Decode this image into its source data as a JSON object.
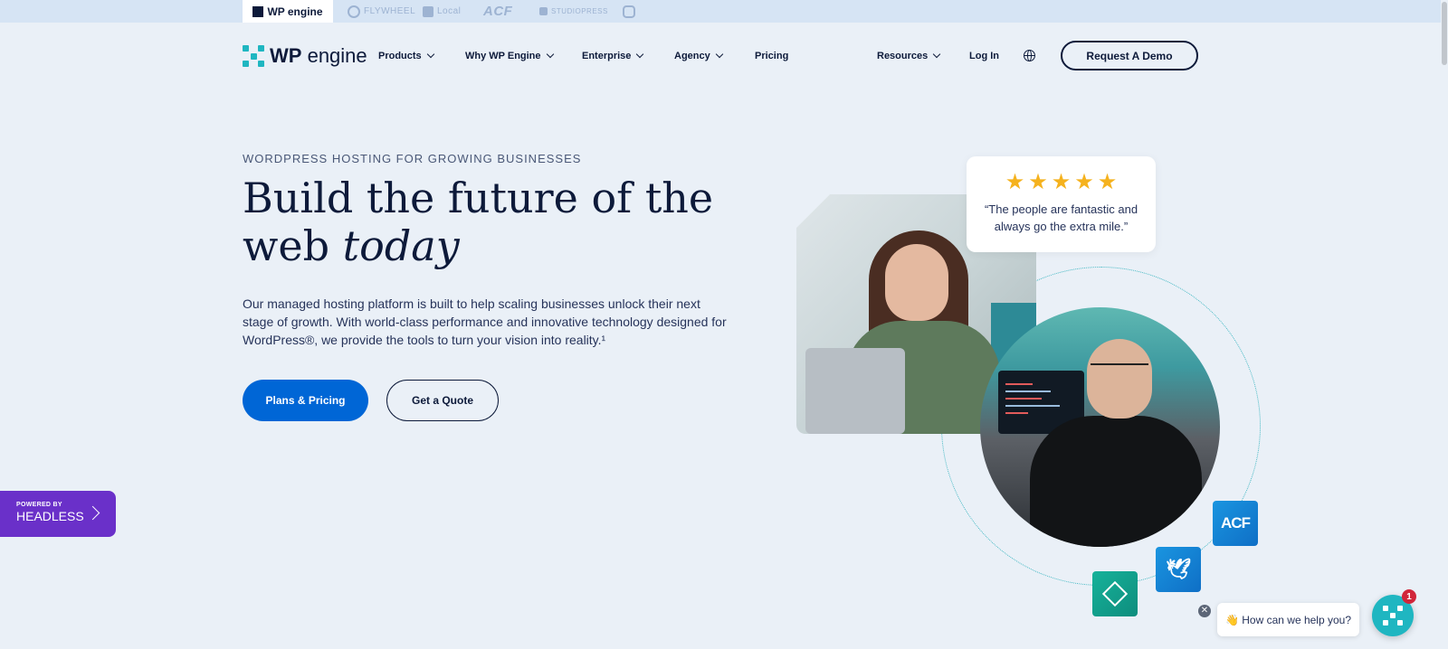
{
  "brandbar": {
    "tabs": [
      {
        "label": "WP engine"
      },
      {
        "label": "FLYWHEEL"
      },
      {
        "label": "Local"
      },
      {
        "label": "ACF"
      },
      {
        "label": "STUDIOPRESS"
      }
    ]
  },
  "nav": {
    "logo_bold": "WP",
    "logo_rest": "engine",
    "items": [
      "Products",
      "Why WP Engine",
      "Enterprise",
      "Agency",
      "Pricing"
    ],
    "resources": "Resources",
    "login": "Log In",
    "demo": "Request A Demo"
  },
  "hero": {
    "eyebrow": "WORDPRESS HOSTING FOR GROWING BUSINESSES",
    "headline_main": "Build the future of the web ",
    "headline_em": "today",
    "body": "Our managed hosting platform is built to help scaling businesses unlock their next stage of growth. With world-class performance and innovative technology designed for WordPress®, we provide the tools to turn your vision into reality.¹",
    "primary_btn": "Plans & Pricing",
    "secondary_btn": "Get a Quote"
  },
  "review": {
    "stars": 5,
    "quote": "“The people are fantastic and always go the extra mile.”"
  },
  "tiles": {
    "acf": "ACF"
  },
  "headless": {
    "small": "POWERED BY",
    "big": "HEADLESS"
  },
  "chat": {
    "prompt": "👋 How can we help you?",
    "badge": "1"
  },
  "colors": {
    "background": "#eaf0f7",
    "primary": "#0066d6",
    "navy": "#0d1a3a",
    "teal": "#1fb6c1",
    "purple": "#6a30c9",
    "star": "#f5b21e"
  }
}
